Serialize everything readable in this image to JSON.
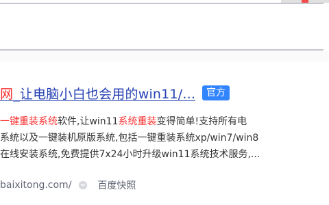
{
  "search": {
    "value": ""
  },
  "result": {
    "title_highlight": "网",
    "title_rest": "_让电脑小白也会用的win11/...",
    "badge": "官方",
    "abstract": [
      [
        {
          "text": "一键重装系统",
          "hl": true
        },
        {
          "text": "软件,让win11",
          "hl": false
        },
        {
          "text": "系统重装",
          "hl": true
        },
        {
          "text": "变得简单!支持所有电",
          "hl": false
        }
      ],
      [
        {
          "text": "系统以及一键装机原版系统,包括一键重装系统xp/win7/win8",
          "hl": false
        }
      ],
      [
        {
          "text": "在线安装系统,免费提供7x24小时升级win11系统技术服务,...",
          "hl": false
        }
      ]
    ],
    "site_url": "baixitong.com/",
    "snapshot_label": "百度快照"
  },
  "colors": {
    "link": "#2440b3",
    "highlight": "#f73131",
    "badge": "#3385ff",
    "meta": "#626675"
  },
  "icons": {
    "trust": "shield-icon"
  }
}
